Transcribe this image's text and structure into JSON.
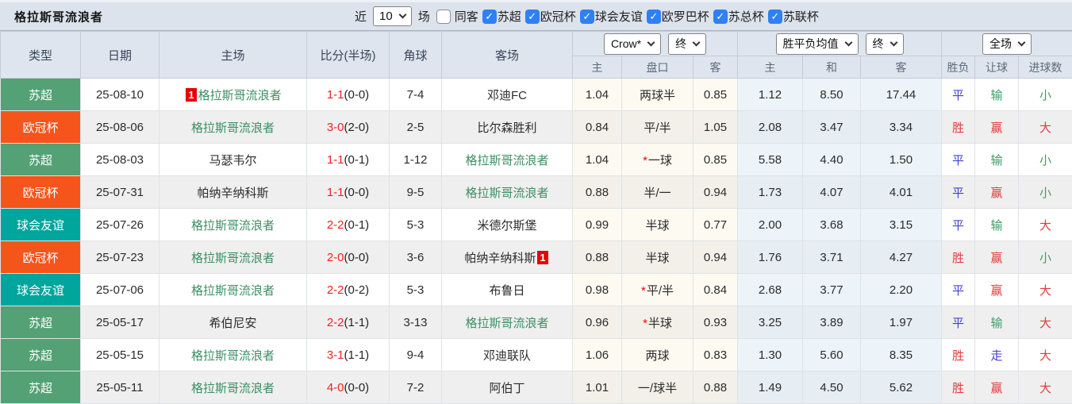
{
  "filter_bar": {
    "team_title": "格拉斯哥流浪者",
    "recent_label": "近",
    "recent_count": "10",
    "matches_label": "场",
    "same_away": {
      "label": "同客",
      "checked": false
    },
    "leagues": [
      {
        "label": "苏超",
        "checked": true
      },
      {
        "label": "欧冠杯",
        "checked": true
      },
      {
        "label": "球会友谊",
        "checked": true
      },
      {
        "label": "欧罗巴杯",
        "checked": true
      },
      {
        "label": "苏总杯",
        "checked": true
      },
      {
        "label": "苏联杯",
        "checked": true
      }
    ]
  },
  "table": {
    "headers": {
      "type": "类型",
      "date": "日期",
      "home": "主场",
      "score": "比分(半场)",
      "corner": "角球",
      "away": "客场",
      "odds_home": "主",
      "odds_handicap": "盘口",
      "odds_away": "客",
      "avg_home": "主",
      "avg_draw": "和",
      "avg_away": "客",
      "result": "胜负",
      "handicap_result": "让球",
      "goals": "进球数"
    },
    "dropdowns": {
      "odds_company": "Crow*",
      "odds_time": "终",
      "avg_label": "胜平负均值",
      "avg_time": "终",
      "period": "全场"
    },
    "rows": [
      {
        "league": "苏超",
        "league_type": "green",
        "date": "25-08-10",
        "home": "格拉斯哥流浪者",
        "home_self": true,
        "home_card": "1",
        "away": "邓迪FC",
        "away_self": false,
        "away_card": "",
        "score": "1-1",
        "half": "(0-0)",
        "corner": "7-4",
        "crown_home": "1.04",
        "handicap": "两球半",
        "handicap_star": false,
        "crown_away": "0.85",
        "avg_home": "1.12",
        "avg_draw": "8.50",
        "avg_away": "17.44",
        "result": "平",
        "result_color": "blue",
        "handicap_result": "输",
        "handicap_result_color": "green",
        "goals": "小",
        "goals_color": "green"
      },
      {
        "league": "欧冠杯",
        "league_type": "orange",
        "date": "25-08-06",
        "home": "格拉斯哥流浪者",
        "home_self": true,
        "home_card": "",
        "away": "比尔森胜利",
        "away_self": false,
        "away_card": "",
        "score": "3-0",
        "half": "(2-0)",
        "corner": "2-5",
        "crown_home": "0.84",
        "handicap": "平/半",
        "handicap_star": false,
        "crown_away": "1.05",
        "avg_home": "2.08",
        "avg_draw": "3.47",
        "avg_away": "3.34",
        "result": "胜",
        "result_color": "red",
        "handicap_result": "赢",
        "handicap_result_color": "red",
        "goals": "大",
        "goals_color": "red"
      },
      {
        "league": "苏超",
        "league_type": "green",
        "date": "25-08-03",
        "home": "马瑟韦尔",
        "home_self": false,
        "home_card": "",
        "away": "格拉斯哥流浪者",
        "away_self": true,
        "away_card": "",
        "score": "1-1",
        "half": "(0-1)",
        "corner": "1-12",
        "crown_home": "1.04",
        "handicap": "一球",
        "handicap_star": true,
        "crown_away": "0.85",
        "avg_home": "5.58",
        "avg_draw": "4.40",
        "avg_away": "1.50",
        "result": "平",
        "result_color": "blue",
        "handicap_result": "输",
        "handicap_result_color": "green",
        "goals": "小",
        "goals_color": "green"
      },
      {
        "league": "欧冠杯",
        "league_type": "orange",
        "date": "25-07-31",
        "home": "帕纳辛纳科斯",
        "home_self": false,
        "home_card": "",
        "away": "格拉斯哥流浪者",
        "away_self": true,
        "away_card": "",
        "score": "1-1",
        "half": "(0-0)",
        "corner": "9-5",
        "crown_home": "0.88",
        "handicap": "半/一",
        "handicap_star": false,
        "crown_away": "0.94",
        "avg_home": "1.73",
        "avg_draw": "4.07",
        "avg_away": "4.01",
        "result": "平",
        "result_color": "blue",
        "handicap_result": "赢",
        "handicap_result_color": "red",
        "goals": "小",
        "goals_color": "green"
      },
      {
        "league": "球会友谊",
        "league_type": "teal",
        "date": "25-07-26",
        "home": "格拉斯哥流浪者",
        "home_self": true,
        "home_card": "",
        "away": "米德尔斯堡",
        "away_self": false,
        "away_card": "",
        "score": "2-2",
        "half": "(0-1)",
        "corner": "5-3",
        "crown_home": "0.99",
        "handicap": "半球",
        "handicap_star": false,
        "crown_away": "0.77",
        "avg_home": "2.00",
        "avg_draw": "3.68",
        "avg_away": "3.15",
        "result": "平",
        "result_color": "blue",
        "handicap_result": "输",
        "handicap_result_color": "green",
        "goals": "大",
        "goals_color": "red"
      },
      {
        "league": "欧冠杯",
        "league_type": "orange",
        "date": "25-07-23",
        "home": "格拉斯哥流浪者",
        "home_self": true,
        "home_card": "",
        "away": "帕纳辛纳科斯",
        "away_self": false,
        "away_card": "1",
        "score": "2-0",
        "half": "(0-0)",
        "corner": "3-6",
        "crown_home": "0.88",
        "handicap": "半球",
        "handicap_star": false,
        "crown_away": "0.94",
        "avg_home": "1.76",
        "avg_draw": "3.71",
        "avg_away": "4.27",
        "result": "胜",
        "result_color": "red",
        "handicap_result": "赢",
        "handicap_result_color": "red",
        "goals": "小",
        "goals_color": "green"
      },
      {
        "league": "球会友谊",
        "league_type": "teal",
        "date": "25-07-06",
        "home": "格拉斯哥流浪者",
        "home_self": true,
        "home_card": "",
        "away": "布鲁日",
        "away_self": false,
        "away_card": "",
        "score": "2-2",
        "half": "(0-2)",
        "corner": "5-3",
        "crown_home": "0.98",
        "handicap": "平/半",
        "handicap_star": true,
        "crown_away": "0.84",
        "avg_home": "2.68",
        "avg_draw": "3.77",
        "avg_away": "2.20",
        "result": "平",
        "result_color": "blue",
        "handicap_result": "赢",
        "handicap_result_color": "red",
        "goals": "大",
        "goals_color": "red"
      },
      {
        "league": "苏超",
        "league_type": "green",
        "date": "25-05-17",
        "home": "希伯尼安",
        "home_self": false,
        "home_card": "",
        "away": "格拉斯哥流浪者",
        "away_self": true,
        "away_card": "",
        "score": "2-2",
        "half": "(1-1)",
        "corner": "3-13",
        "crown_home": "0.96",
        "handicap": "半球",
        "handicap_star": true,
        "crown_away": "0.93",
        "avg_home": "3.25",
        "avg_draw": "3.89",
        "avg_away": "1.97",
        "result": "平",
        "result_color": "blue",
        "handicap_result": "输",
        "handicap_result_color": "green",
        "goals": "大",
        "goals_color": "red"
      },
      {
        "league": "苏超",
        "league_type": "green",
        "date": "25-05-15",
        "home": "格拉斯哥流浪者",
        "home_self": true,
        "home_card": "",
        "away": "邓迪联队",
        "away_self": false,
        "away_card": "",
        "score": "3-1",
        "half": "(1-1)",
        "corner": "9-4",
        "crown_home": "1.06",
        "handicap": "两球",
        "handicap_star": false,
        "crown_away": "0.83",
        "avg_home": "1.30",
        "avg_draw": "5.60",
        "avg_away": "8.35",
        "result": "胜",
        "result_color": "red",
        "handicap_result": "走",
        "handicap_result_color": "blue",
        "goals": "大",
        "goals_color": "red"
      },
      {
        "league": "苏超",
        "league_type": "green",
        "date": "25-05-11",
        "home": "格拉斯哥流浪者",
        "home_self": true,
        "home_card": "",
        "away": "阿伯丁",
        "away_self": false,
        "away_card": "",
        "score": "4-0",
        "half": "(0-0)",
        "corner": "7-2",
        "crown_home": "1.01",
        "handicap": "一/球半",
        "handicap_star": false,
        "crown_away": "0.88",
        "avg_home": "1.49",
        "avg_draw": "4.50",
        "avg_away": "5.62",
        "result": "胜",
        "result_color": "red",
        "handicap_result": "赢",
        "handicap_result_color": "red",
        "goals": "大",
        "goals_color": "red"
      }
    ]
  },
  "colors": {
    "bar-bg": "#dce3ed",
    "head-bg": "#dfe5ee",
    "grid": "#dfe2e7",
    "hgrid": "#c2ccd9",
    "outer": "#a9b3c1",
    "alt": "#efefef",
    "cream1": "#fdfaf1",
    "cream2": "#f3f0e9",
    "blue1": "#ecf4f9",
    "blue2": "#e6edf3",
    "b-green": "#53a175",
    "b-orange": "#f5551a",
    "b-teal": "#00a59c",
    "self": "#3c8f63",
    "score": "#f02222",
    "red": "#e23b3b",
    "bluet": "#4240d8",
    "greent": "#3e9d68",
    "card": "#e60000",
    "cb": "#2f80f5"
  }
}
